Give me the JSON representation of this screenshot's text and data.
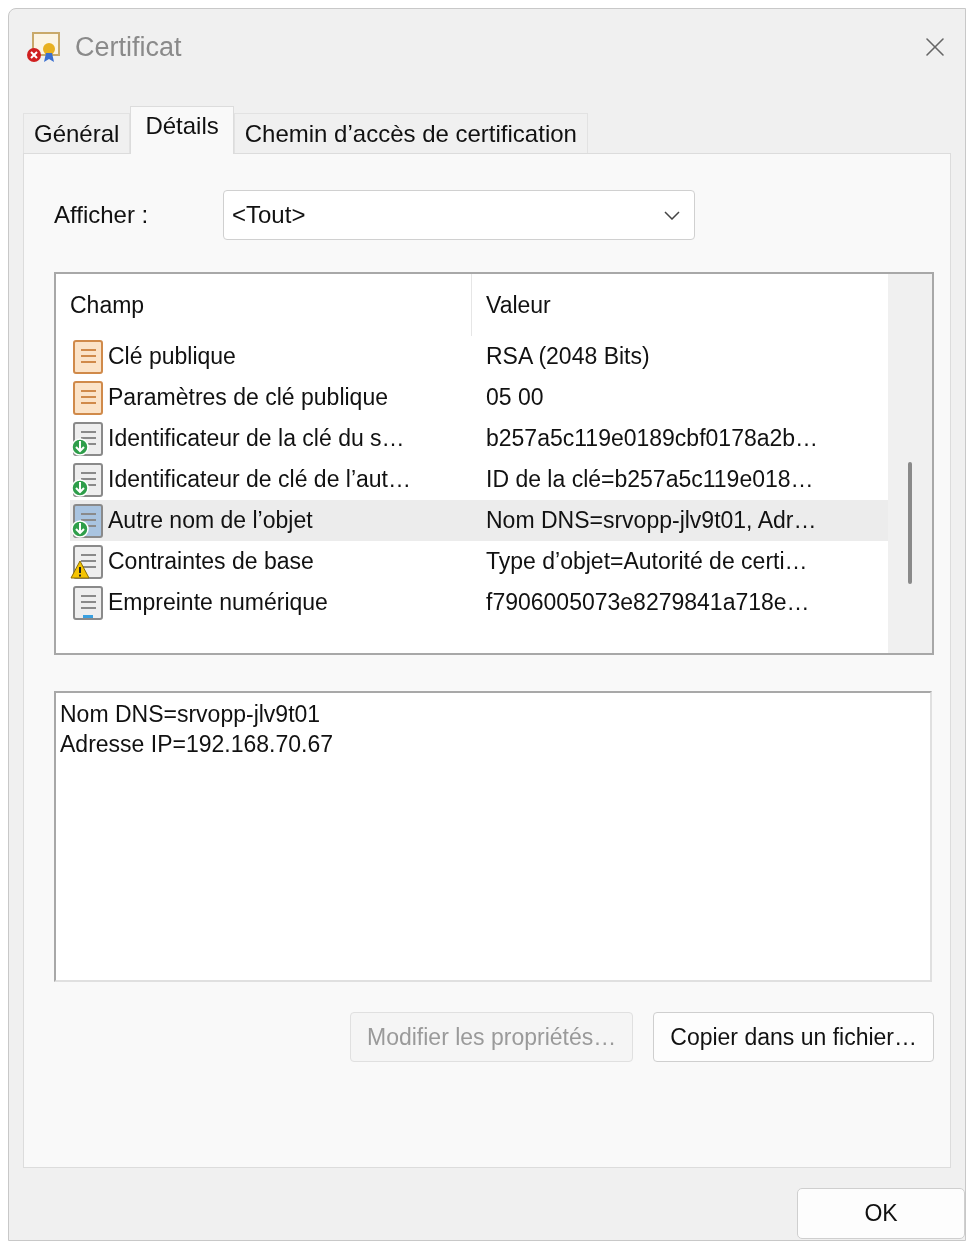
{
  "window": {
    "title": "Certificat"
  },
  "tabs": [
    {
      "label": "Général",
      "selected": false
    },
    {
      "label": "Détails",
      "selected": true
    },
    {
      "label": "Chemin d’accès de certification",
      "selected": false
    }
  ],
  "show": {
    "label": "Afficher :",
    "value": "<Tout>"
  },
  "table": {
    "columns": [
      "Champ",
      "Valeur"
    ],
    "rows": [
      {
        "kind": "key",
        "field": "Clé publique",
        "value": "RSA (2048 Bits)",
        "selected": false
      },
      {
        "kind": "key",
        "field": "Paramètres de clé publique",
        "value": "05 00",
        "selected": false
      },
      {
        "kind": "extension",
        "field": "Identificateur de la clé du s…",
        "value": "b257a5c119e0189cbf0178a2b…",
        "selected": false
      },
      {
        "kind": "extension",
        "field": "Identificateur de clé de l’aut…",
        "value": "ID de la clé=b257a5c119e018…",
        "selected": false
      },
      {
        "kind": "extension",
        "field": "Autre nom de l’objet",
        "value": "Nom DNS=srvopp-jlv9t01, Adr…",
        "selected": true
      },
      {
        "kind": "warning",
        "field": "Contraintes de base",
        "value": "Type d’objet=Autorité de certi…",
        "selected": false
      },
      {
        "kind": "property",
        "field": "Empreinte numérique",
        "value": "f7906005073e8279841a718e…",
        "selected": false
      }
    ]
  },
  "detail_lines": [
    "Nom DNS=srvopp-jlv9t01",
    "Adresse IP=192.168.70.67"
  ],
  "buttons": [
    {
      "label": "Modifier les propriétés…",
      "disabled": true
    },
    {
      "label": "Copier dans un fichier…",
      "disabled": false
    }
  ],
  "ok_button": {
    "label": "OK"
  }
}
